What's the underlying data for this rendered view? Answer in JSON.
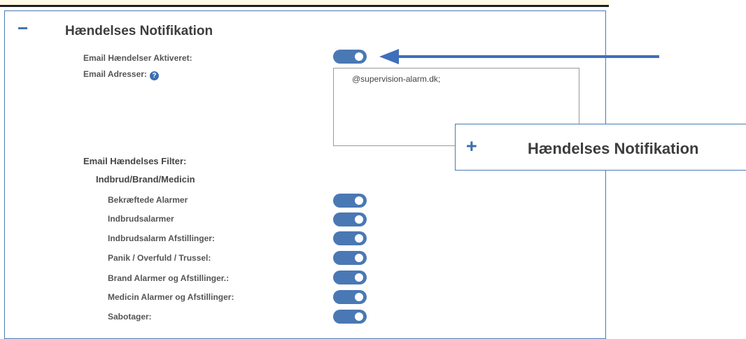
{
  "section": {
    "collapse_symbol": "−",
    "title": "Hændelses Notifikation"
  },
  "email_enabled": {
    "label": "Email Hændelser Aktiveret:",
    "value": true
  },
  "email_addresses": {
    "label": "Email Adresser:",
    "help_symbol": "?",
    "value": "@supervision-alarm.dk;"
  },
  "filter": {
    "label": "Email Hændelses Filter:",
    "group_label": "Indbrud/Brand/Medicin",
    "items": [
      {
        "label": "Bekræftede Alarmer",
        "value": true
      },
      {
        "label": "Indbrudsalarmer",
        "value": true
      },
      {
        "label": "Indbrudsalarm Afstillinger:",
        "value": true
      },
      {
        "label": "Panik / Overfuld / Trussel:",
        "value": true
      },
      {
        "label": "Brand Alarmer og Afstillinger.:",
        "value": true
      },
      {
        "label": "Medicin Alarmer og Afstillinger:",
        "value": true
      },
      {
        "label": "Sabotager:",
        "value": true
      }
    ]
  },
  "callout": {
    "expand_symbol": "+",
    "title": "Hændelses Notifikation"
  },
  "colors": {
    "accent": "#3a6fb0",
    "toggle_on": "#4a78b4",
    "arrow": "#3f6fbb"
  }
}
